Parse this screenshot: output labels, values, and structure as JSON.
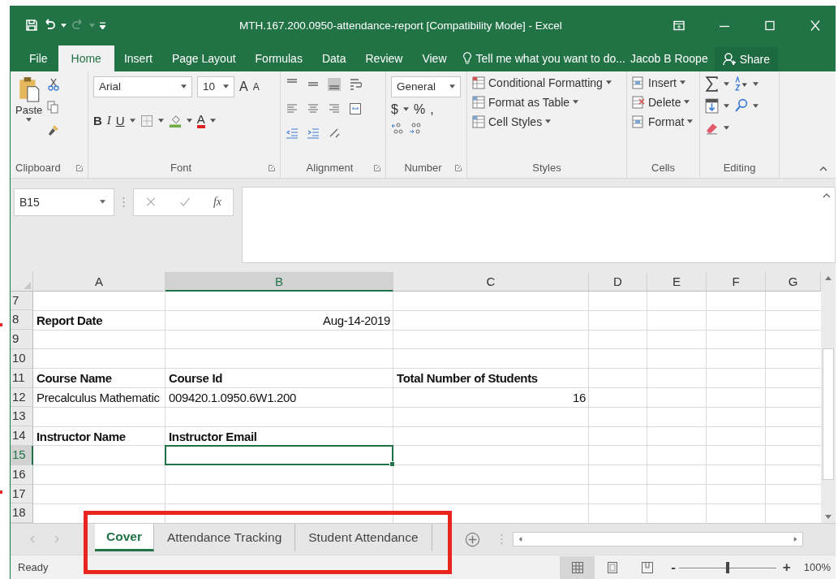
{
  "window": {
    "title": "MTH.167.200.0950-attendance-report  [Compatibility Mode] - Excel"
  },
  "ribbon_tabs": [
    {
      "label": "File",
      "selected": false
    },
    {
      "label": "Home",
      "selected": true
    },
    {
      "label": "Insert",
      "selected": false
    },
    {
      "label": "Page Layout",
      "selected": false
    },
    {
      "label": "Formulas",
      "selected": false
    },
    {
      "label": "Data",
      "selected": false
    },
    {
      "label": "Review",
      "selected": false
    },
    {
      "label": "View",
      "selected": false
    }
  ],
  "tell_me": "Tell me what you want to do...",
  "user": "Jacob B Roope",
  "share": "Share",
  "clipboard": {
    "paste": "Paste",
    "label": "Clipboard"
  },
  "font": {
    "name": "Arial",
    "size": "10",
    "grow": "A",
    "shrink": "A",
    "styles": [
      "B",
      "I",
      "U"
    ],
    "color_letter": "A",
    "label": "Font"
  },
  "alignment": {
    "label": "Alignment"
  },
  "number": {
    "format": "General",
    "currency": "$",
    "percent": "%",
    "comma": ",",
    "label": "Number"
  },
  "styles": {
    "items": [
      "Conditional Formatting",
      "Format as Table",
      "Cell Styles"
    ],
    "label": "Styles"
  },
  "cells": {
    "items": [
      "Insert",
      "Delete",
      "Format"
    ],
    "label": "Cells"
  },
  "editing": {
    "label": "Editing"
  },
  "formula_bar": {
    "name_box": "B15",
    "function_label": "fx"
  },
  "sheet": {
    "columns": [
      {
        "label": "A",
        "selected": false
      },
      {
        "label": "B",
        "selected": true
      },
      {
        "label": "C",
        "selected": false
      },
      {
        "label": "D",
        "selected": false
      },
      {
        "label": "E",
        "selected": false
      },
      {
        "label": "F",
        "selected": false
      },
      {
        "label": "G",
        "selected": false
      }
    ],
    "rows": [
      {
        "number": "7",
        "selected": false
      },
      {
        "number": "8",
        "selected": false,
        "cells": [
          {
            "text": "Report Date",
            "bold": true,
            "kind": "text"
          },
          {
            "text": "Aug-14-2019",
            "bold": false,
            "kind": "date"
          }
        ]
      },
      {
        "number": "9",
        "selected": false
      },
      {
        "number": "10",
        "selected": false
      },
      {
        "number": "11",
        "selected": false,
        "cells": [
          {
            "text": "Course Name",
            "bold": true,
            "kind": "text"
          },
          {
            "text": "Course Id",
            "bold": true,
            "kind": "text"
          },
          {
            "text": "Total Number of Students",
            "bold": true,
            "kind": "text"
          }
        ]
      },
      {
        "number": "12",
        "selected": false,
        "cells": [
          {
            "text": "Precalculus Mathematic",
            "bold": false,
            "kind": "text"
          },
          {
            "text": "009420.1.0950.6W1.200",
            "bold": false,
            "kind": "text"
          },
          {
            "text": "16",
            "bold": false,
            "kind": "number"
          }
        ]
      },
      {
        "number": "13",
        "selected": false
      },
      {
        "number": "14",
        "selected": false,
        "cells": [
          {
            "text": "Instructor Name",
            "bold": true,
            "kind": "text"
          },
          {
            "text": "Instructor Email",
            "bold": true,
            "kind": "text"
          }
        ]
      },
      {
        "number": "15",
        "selected": true
      },
      {
        "number": "16",
        "selected": false
      },
      {
        "number": "17",
        "selected": false
      },
      {
        "number": "18",
        "selected": false
      }
    ]
  },
  "sheet_tabs": [
    {
      "label": "Cover",
      "selected": true
    },
    {
      "label": "Attendance Tracking",
      "selected": false
    },
    {
      "label": "Student Attendance",
      "selected": false
    }
  ],
  "status_bar": {
    "status": "Ready",
    "views": [
      {
        "kind": "normal",
        "selected": true
      },
      {
        "kind": "page_layout",
        "selected": false
      },
      {
        "kind": "page_break",
        "selected": false
      }
    ],
    "zoom_out": "-",
    "zoom_in": "+",
    "zoom": {
      "level": 0.5
    },
    "zoom_text": "100%"
  }
}
